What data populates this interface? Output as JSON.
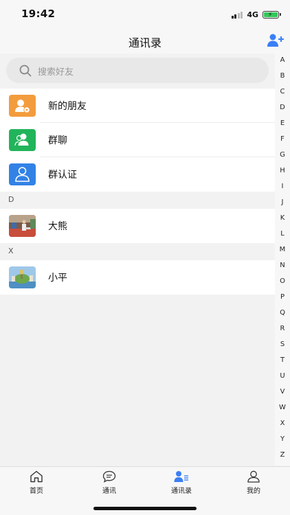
{
  "status_bar": {
    "time": "19:42",
    "network": "4G"
  },
  "nav": {
    "title": "通讯录",
    "add_icon": "add-friend-icon",
    "accent": "#3b7ff5"
  },
  "search": {
    "placeholder": "搜索好友"
  },
  "functions": [
    {
      "label": "新的朋友",
      "icon": "new-friend-icon",
      "color": "#f39c3d"
    },
    {
      "label": "群聊",
      "icon": "group-chat-icon",
      "color": "#22b45b"
    },
    {
      "label": "群认证",
      "icon": "group-verify-icon",
      "color": "#3282e6"
    }
  ],
  "sections": [
    {
      "letter": "D",
      "contacts": [
        {
          "name": "大熊"
        }
      ]
    },
    {
      "letter": "X",
      "contacts": [
        {
          "name": "小平"
        }
      ]
    }
  ],
  "index_letters": [
    "A",
    "B",
    "C",
    "D",
    "E",
    "F",
    "G",
    "H",
    "I",
    "J",
    "K",
    "L",
    "M",
    "N",
    "O",
    "P",
    "Q",
    "R",
    "S",
    "T",
    "U",
    "V",
    "W",
    "X",
    "Y",
    "Z"
  ],
  "tabs": [
    {
      "label": "首页",
      "icon": "home-icon",
      "active": false
    },
    {
      "label": "通讯",
      "icon": "chat-bubble-icon",
      "active": false
    },
    {
      "label": "通讯录",
      "icon": "contacts-icon",
      "active": true
    },
    {
      "label": "我的",
      "icon": "profile-icon",
      "active": false
    }
  ]
}
